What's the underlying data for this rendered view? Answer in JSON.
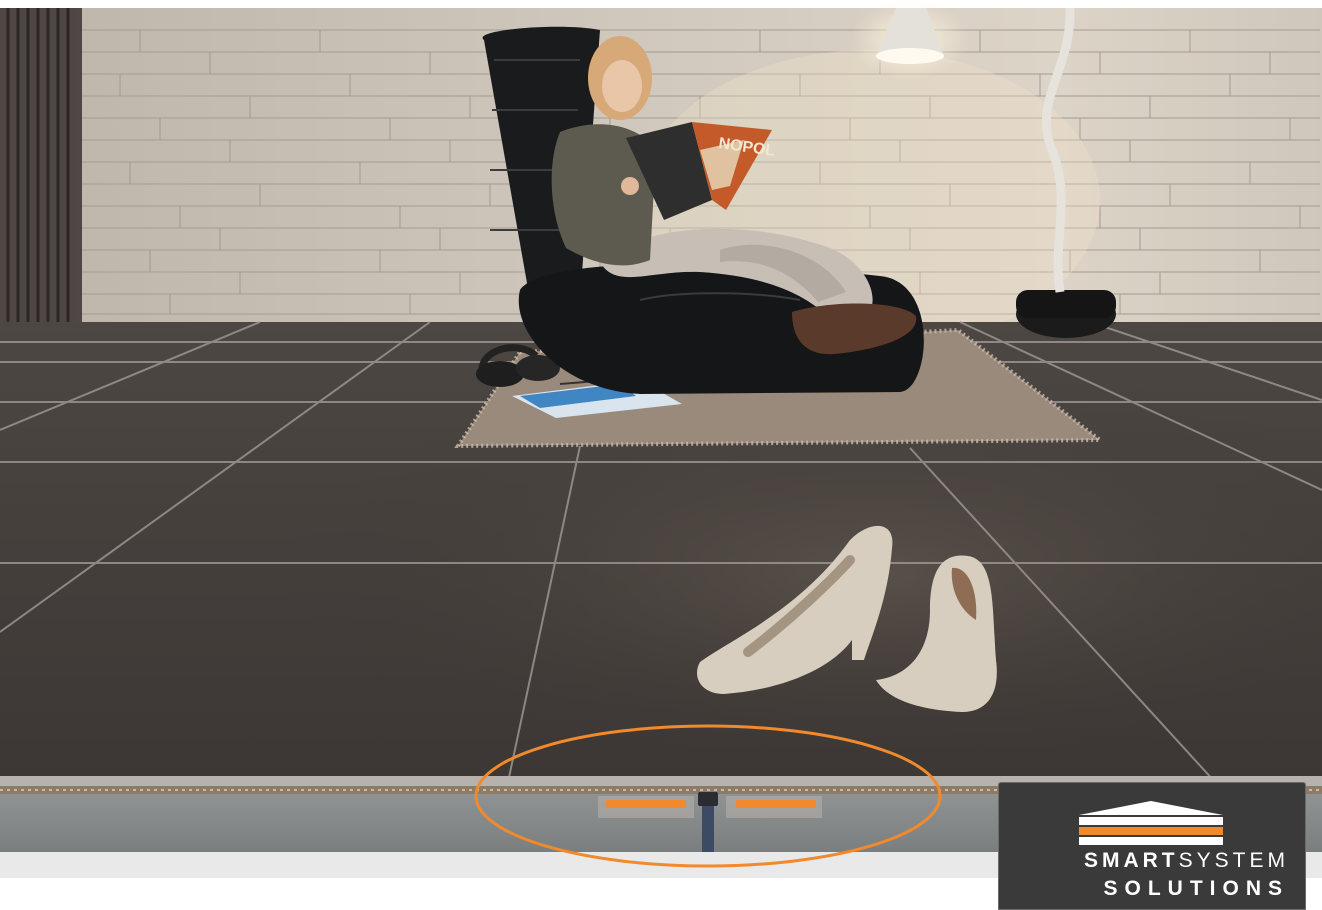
{
  "photo": {
    "subject": "woman-reading-magazine-on-tiled-floor",
    "highlight_color": "#f08a2c"
  },
  "magazine": {
    "cover_text": "NOPOL"
  },
  "logo": {
    "word_bold": "SMART",
    "word_light": "SYSTEM",
    "line2": "SOLUTIONS",
    "accent_color": "#f08a2c"
  }
}
